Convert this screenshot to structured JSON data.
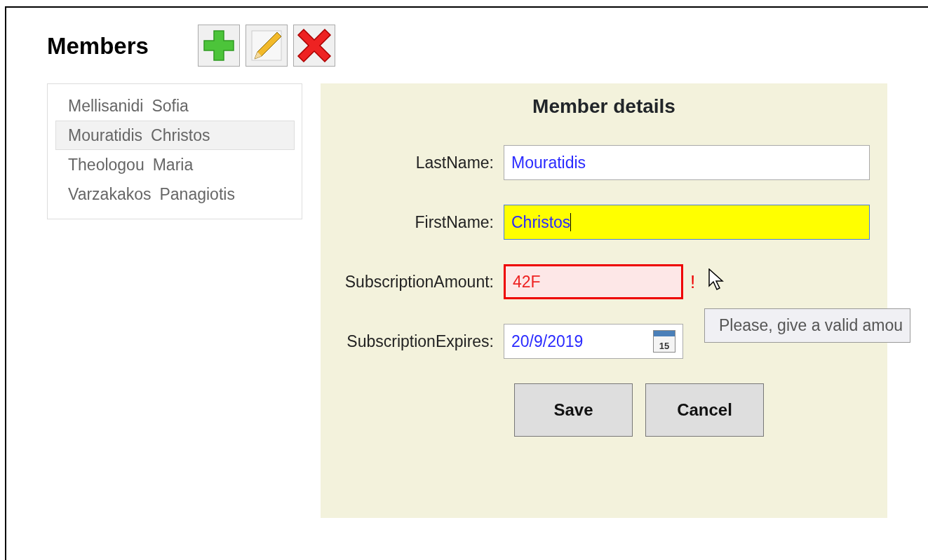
{
  "title": "Members",
  "toolbar": [
    {
      "kind": "add"
    },
    {
      "kind": "edit"
    },
    {
      "kind": "delete"
    }
  ],
  "members": [
    {
      "last_name": "Mellisanidi",
      "first_name": "Sofia",
      "selected": false
    },
    {
      "last_name": "Mouratidis",
      "first_name": "Christos",
      "selected": true
    },
    {
      "last_name": "Theologou",
      "first_name": "Maria",
      "selected": false
    },
    {
      "last_name": "Varzakakos",
      "first_name": "Panagiotis",
      "selected": false
    }
  ],
  "details": {
    "title": "Member details",
    "fields": [
      {
        "label": "LastName:",
        "value": "Mouratidis",
        "kind": "text",
        "focused": false,
        "invalid": false
      },
      {
        "label": "FirstName:",
        "value": "Christos",
        "kind": "text",
        "focused": true,
        "invalid": false
      },
      {
        "label": "SubscriptionAmount:",
        "value": "42F",
        "kind": "number",
        "focused": false,
        "invalid": true,
        "error_mark": "!",
        "tooltip": "Please, give a valid amou"
      },
      {
        "label": "SubscriptionExpires:",
        "value": "20/9/2019",
        "kind": "date",
        "focused": false,
        "invalid": false,
        "calendar_day": "15"
      }
    ],
    "buttons": [
      "Save",
      "Cancel"
    ]
  }
}
